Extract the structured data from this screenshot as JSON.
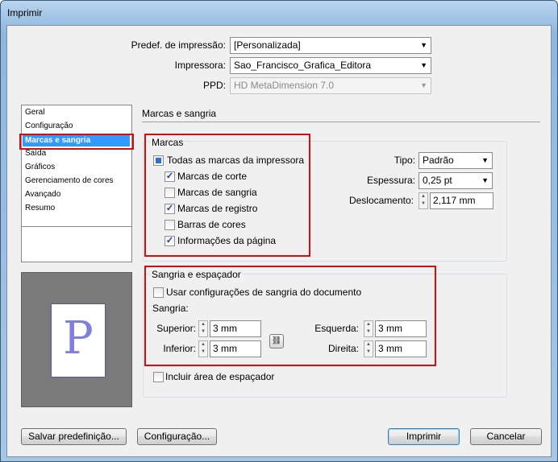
{
  "window": {
    "title": "Imprimir"
  },
  "top": {
    "preset_label": "Predef. de impressão:",
    "preset_value": "[Personalizada]",
    "printer_label": "Impressora:",
    "printer_value": "Sao_Francisco_Grafica_Editora",
    "ppd_label": "PPD:",
    "ppd_value": "HD MetaDimension 7.0"
  },
  "sidebar": {
    "items": [
      {
        "label": "Geral"
      },
      {
        "label": "Configuração"
      },
      {
        "label": "Marcas e sangria",
        "selected": true
      },
      {
        "label": "Saída"
      },
      {
        "label": "Gráficos"
      },
      {
        "label": "Gerenciamento de cores"
      },
      {
        "label": "Avançado"
      },
      {
        "label": "Resumo"
      }
    ]
  },
  "preview": {
    "letter": "P"
  },
  "section_title": "Marcas e sangria",
  "marks": {
    "title": "Marcas",
    "all": {
      "label": "Todas as marcas da impressora",
      "state": "partial"
    },
    "items": [
      {
        "label": "Marcas de corte",
        "checked": true
      },
      {
        "label": "Marcas de sangria",
        "checked": false
      },
      {
        "label": "Marcas de registro",
        "checked": true
      },
      {
        "label": "Barras de cores",
        "checked": false
      },
      {
        "label": "Informações da página",
        "checked": true
      }
    ],
    "type_label": "Tipo:",
    "type_value": "Padrão",
    "weight_label": "Espessura:",
    "weight_value": "0,25 pt",
    "offset_label": "Deslocamento:",
    "offset_value": "2,117 mm"
  },
  "bleed": {
    "title": "Sangria e espaçador",
    "use_doc_label": "Usar configurações de sangria do documento",
    "use_doc_checked": false,
    "bleed_label": "Sangria:",
    "top_label": "Superior:",
    "top_value": "3 mm",
    "bottom_label": "Inferior:",
    "bottom_value": "3 mm",
    "left_label": "Esquerda:",
    "left_value": "3 mm",
    "right_label": "Direita:",
    "right_value": "3 mm",
    "slug_label": "Incluir área de espaçador",
    "slug_checked": false
  },
  "buttons": {
    "save_preset": "Salvar predefinição...",
    "setup": "Configuração...",
    "print": "Imprimir",
    "cancel": "Cancelar"
  },
  "colors": {
    "highlight": "#3399ff",
    "annotation": "#d01010"
  }
}
